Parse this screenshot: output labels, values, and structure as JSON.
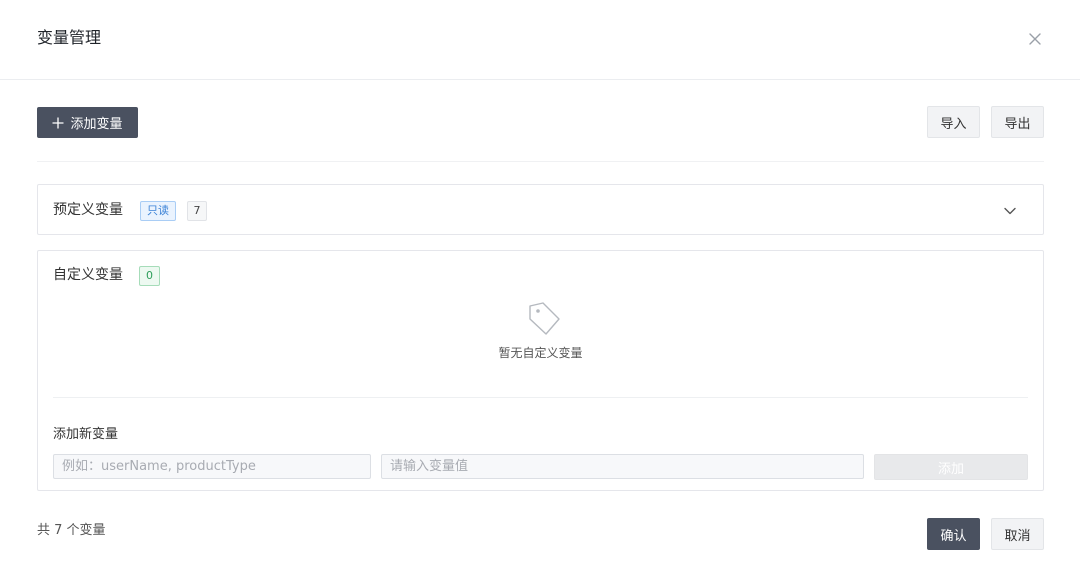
{
  "dialog": {
    "title": "变量管理",
    "close_icon": "close-icon"
  },
  "toolbar": {
    "add_variable_label": "添加变量",
    "add_icon": "plus-icon",
    "import_label": "导入",
    "export_label": "导出"
  },
  "predefined": {
    "title": "预定义变量",
    "readonly_tag": "只读",
    "count": "7",
    "expand_icon": "chevron-down-icon"
  },
  "custom": {
    "title": "自定义变量",
    "count": "0",
    "empty_icon": "tag-icon",
    "empty_text": "暂无自定义变量",
    "new_variable_label": "添加新变量",
    "name_input": {
      "value": "",
      "placeholder": "例如：userName, productType"
    },
    "value_input": {
      "value": "",
      "placeholder": "请输入变量值"
    },
    "add_button_label": "添加"
  },
  "footer": {
    "total_text": "共 7 个变量",
    "confirm_label": "确认",
    "cancel_label": "取消"
  },
  "colors": {
    "primary_button": "#4a5160",
    "readonly_tag": "#3b82d6",
    "count_zero_tag": "#2e9e5b"
  }
}
